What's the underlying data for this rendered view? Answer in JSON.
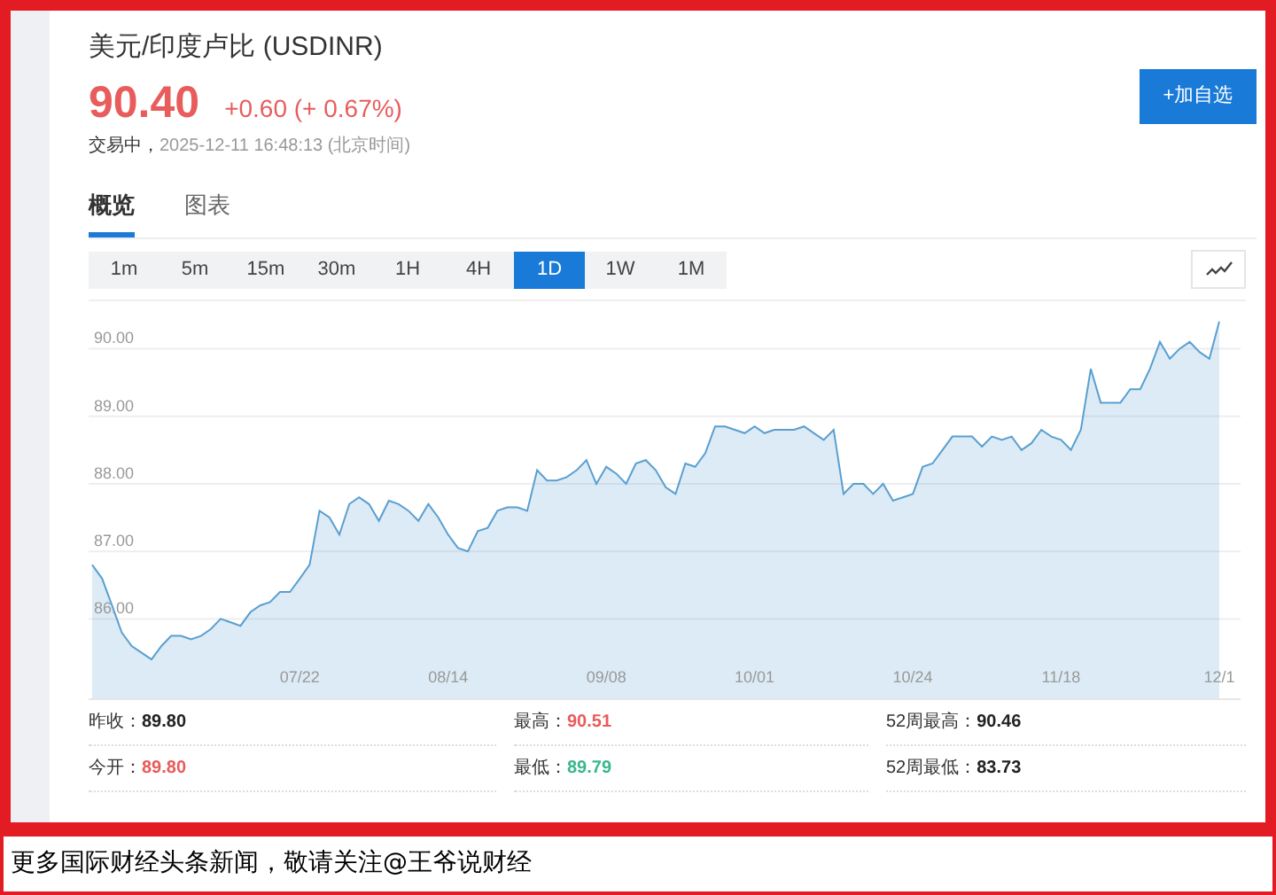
{
  "header": {
    "title": "美元/印度卢比 (USDINR)",
    "price": "90.40",
    "change": "+0.60 (+ 0.67%)",
    "status": "交易中，",
    "timestamp": "2025-12-11 16:48:13 (北京时间)",
    "add_button": "+加自选"
  },
  "tabs": [
    {
      "label": "概览",
      "selected": true
    },
    {
      "label": "图表",
      "selected": false
    }
  ],
  "periods": [
    {
      "label": "1m",
      "selected": false
    },
    {
      "label": "5m",
      "selected": false
    },
    {
      "label": "15m",
      "selected": false
    },
    {
      "label": "30m",
      "selected": false
    },
    {
      "label": "1H",
      "selected": false
    },
    {
      "label": "4H",
      "selected": false
    },
    {
      "label": "1D",
      "selected": true
    },
    {
      "label": "1W",
      "selected": false
    },
    {
      "label": "1M",
      "selected": false
    }
  ],
  "chart": {
    "chart_data": {
      "type": "area",
      "categories": [
        null,
        null,
        null,
        null,
        null,
        null,
        null,
        null,
        null,
        null,
        null,
        null,
        null,
        null,
        null,
        null,
        null,
        null,
        null,
        null,
        null,
        "07/22",
        null,
        null,
        null,
        null,
        null,
        null,
        null,
        null,
        null,
        null,
        null,
        null,
        null,
        null,
        "08/14",
        null,
        null,
        null,
        null,
        null,
        null,
        null,
        null,
        null,
        null,
        null,
        null,
        null,
        null,
        null,
        "09/08",
        null,
        null,
        null,
        null,
        null,
        null,
        null,
        null,
        null,
        null,
        null,
        null,
        null,
        null,
        "10/01",
        null,
        null,
        null,
        null,
        null,
        null,
        null,
        null,
        null,
        null,
        null,
        null,
        null,
        null,
        null,
        "10/24",
        null,
        null,
        null,
        null,
        null,
        null,
        null,
        null,
        null,
        null,
        null,
        null,
        null,
        null,
        "11/18",
        null,
        null,
        null,
        null,
        null,
        null,
        null,
        null,
        null,
        null,
        null,
        null,
        null,
        null,
        null,
        "12/1"
      ],
      "grid": true,
      "ylim": [
        84.8,
        90.7
      ],
      "yticks": [
        {
          "value": 86,
          "label": "86.00"
        },
        {
          "value": 87,
          "label": "87.00"
        },
        {
          "value": 88,
          "label": "88.00"
        },
        {
          "value": 89,
          "label": "89.00"
        },
        {
          "value": 90,
          "label": "90.00"
        }
      ],
      "series": [
        {
          "color": "#5a9fd0",
          "values": [
            86.8,
            86.6,
            86.2,
            85.8,
            85.6,
            85.5,
            85.4,
            85.6,
            85.75,
            85.75,
            85.7,
            85.75,
            85.85,
            86.0,
            85.95,
            85.9,
            86.1,
            86.2,
            86.25,
            86.4,
            86.4,
            86.6,
            86.8,
            87.6,
            87.5,
            87.25,
            87.7,
            87.8,
            87.7,
            87.45,
            87.75,
            87.7,
            87.6,
            87.45,
            87.7,
            87.5,
            87.25,
            87.05,
            87.0,
            87.3,
            87.35,
            87.6,
            87.65,
            87.65,
            87.6,
            88.2,
            88.05,
            88.05,
            88.1,
            88.2,
            88.35,
            88.0,
            88.25,
            88.15,
            88.0,
            88.3,
            88.35,
            88.2,
            87.95,
            87.85,
            88.3,
            88.25,
            88.45,
            88.85,
            88.85,
            88.8,
            88.75,
            88.85,
            88.75,
            88.8,
            88.8,
            88.8,
            88.85,
            88.75,
            88.65,
            88.8,
            87.85,
            88.0,
            88.0,
            87.85,
            88.0,
            87.75,
            87.8,
            87.85,
            88.25,
            88.3,
            88.5,
            88.7,
            88.7,
            88.7,
            88.55,
            88.7,
            88.65,
            88.7,
            88.5,
            88.6,
            88.8,
            88.7,
            88.65,
            88.5,
            88.8,
            89.7,
            89.2,
            89.2,
            89.2,
            89.4,
            89.4,
            89.7,
            90.1,
            89.85,
            90.0,
            90.1,
            89.95,
            89.85,
            90.4
          ]
        }
      ]
    }
  },
  "stats": [
    {
      "label": "昨收：",
      "value": "89.80",
      "color": "#222222"
    },
    {
      "label": "最高：",
      "value": "90.51",
      "color": "#e85c5c"
    },
    {
      "label": "52周最高：",
      "value": "90.46",
      "color": "#222222"
    },
    {
      "label": "今开：",
      "value": "89.80",
      "color": "#e85c5c"
    },
    {
      "label": "最低：",
      "value": "89.79",
      "color": "#3cb88a"
    },
    {
      "label": "52周最低：",
      "value": "83.73",
      "color": "#222222"
    }
  ],
  "caption": "更多国际财经头条新闻，敬请关注@王爷说财经"
}
